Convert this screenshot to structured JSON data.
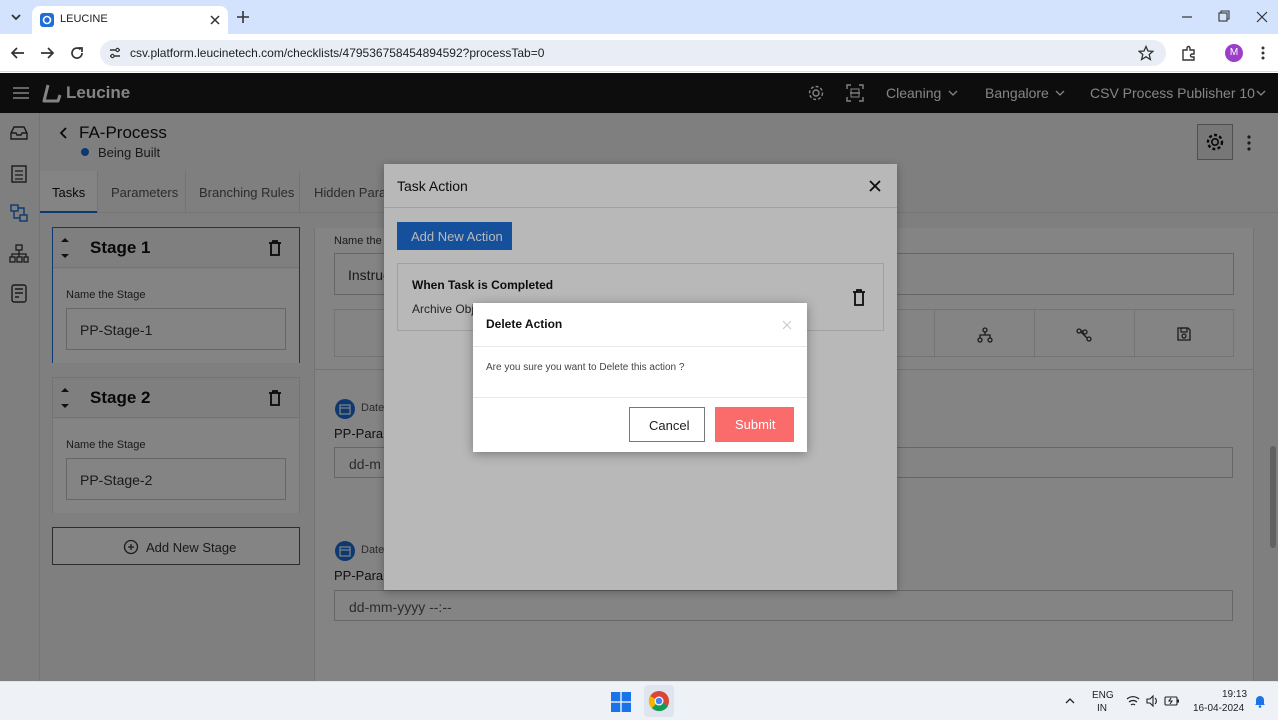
{
  "browser": {
    "tab_title": "LEUCINE",
    "url": "csv.platform.leucinetech.com/checklists/479536758454894592?processTab=0",
    "profile_initial": "M"
  },
  "app": {
    "brand": "Leucine",
    "header": {
      "facility": "Cleaning",
      "site": "Bangalore",
      "user": "CSV Process Publisher 10"
    }
  },
  "process": {
    "title": "FA-Process",
    "status": "Being Built",
    "status_color": "#1d6fd8"
  },
  "tabs": [
    "Tasks",
    "Parameters",
    "Branching Rules",
    "Hidden Paran"
  ],
  "stages": [
    {
      "title": "Stage 1",
      "label": "Name the Stage",
      "value": "PP-Stage-1"
    },
    {
      "title": "Stage 2",
      "label": "Name the Stage",
      "value": "PP-Stage-2"
    }
  ],
  "add_stage_label": "Add New Stage",
  "task_panel": {
    "name_label": "Name the t",
    "name_value": "Instruc",
    "param1_type": "Date",
    "param1_name": "PP-Paran",
    "param1_value": "dd-m",
    "param2_type": "Date",
    "param2_name": "PP-Paran",
    "param2_value": "dd-mm-yyyy --:--"
  },
  "task_action": {
    "title": "Task Action",
    "add_label": "Add New Action",
    "trigger": "When Task is Completed",
    "action": "Archive Obj"
  },
  "delete_modal": {
    "title": "Delete Action",
    "message": "Are you sure you want to Delete this action ?",
    "cancel": "Cancel",
    "submit": "Submit",
    "submit_color": "#fa6b6b"
  },
  "taskbar": {
    "lang1": "ENG",
    "lang2": "IN",
    "time": "19:13",
    "date": "16-04-2024"
  }
}
